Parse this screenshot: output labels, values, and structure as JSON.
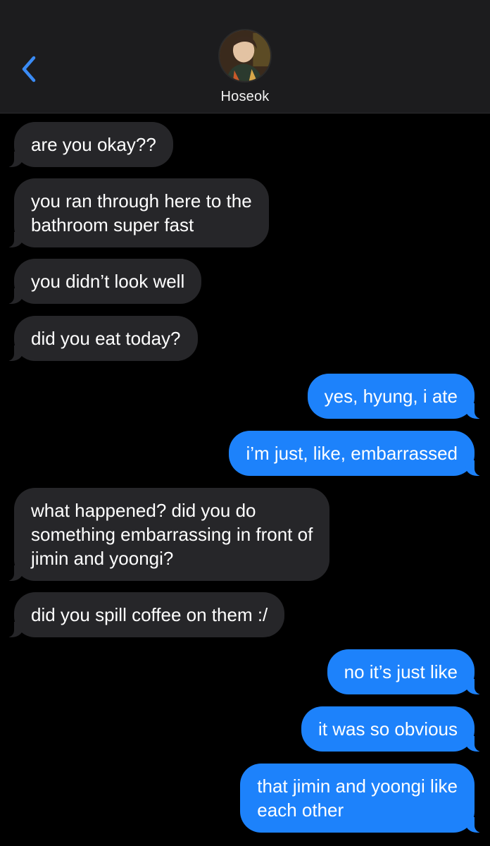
{
  "header": {
    "contact_name": "Hoseok",
    "back_icon": "chevron-left-icon",
    "accent_color": "#3a8bf5"
  },
  "colors": {
    "incoming_bubble": "#262629",
    "outgoing_bubble": "#1d82fb",
    "background": "#000000"
  },
  "messages": [
    {
      "from": "them",
      "text": "are you okay??"
    },
    {
      "from": "them",
      "text": "you ran through here to the\nbathroom super fast"
    },
    {
      "from": "them",
      "text": "you didn’t look well"
    },
    {
      "from": "them",
      "text": "did you eat today?"
    },
    {
      "from": "me",
      "text": "yes, hyung, i ate"
    },
    {
      "from": "me",
      "text": "i’m just, like, embarrassed"
    },
    {
      "from": "them",
      "text": "what happened? did you do\nsomething embarrassing in front of\njimin and yoongi?"
    },
    {
      "from": "them",
      "text": "did you spill coffee on them :/"
    },
    {
      "from": "me",
      "text": "no it’s just like"
    },
    {
      "from": "me",
      "text": "it was so obvious"
    },
    {
      "from": "me",
      "text": "that jimin and yoongi like\neach other"
    }
  ]
}
